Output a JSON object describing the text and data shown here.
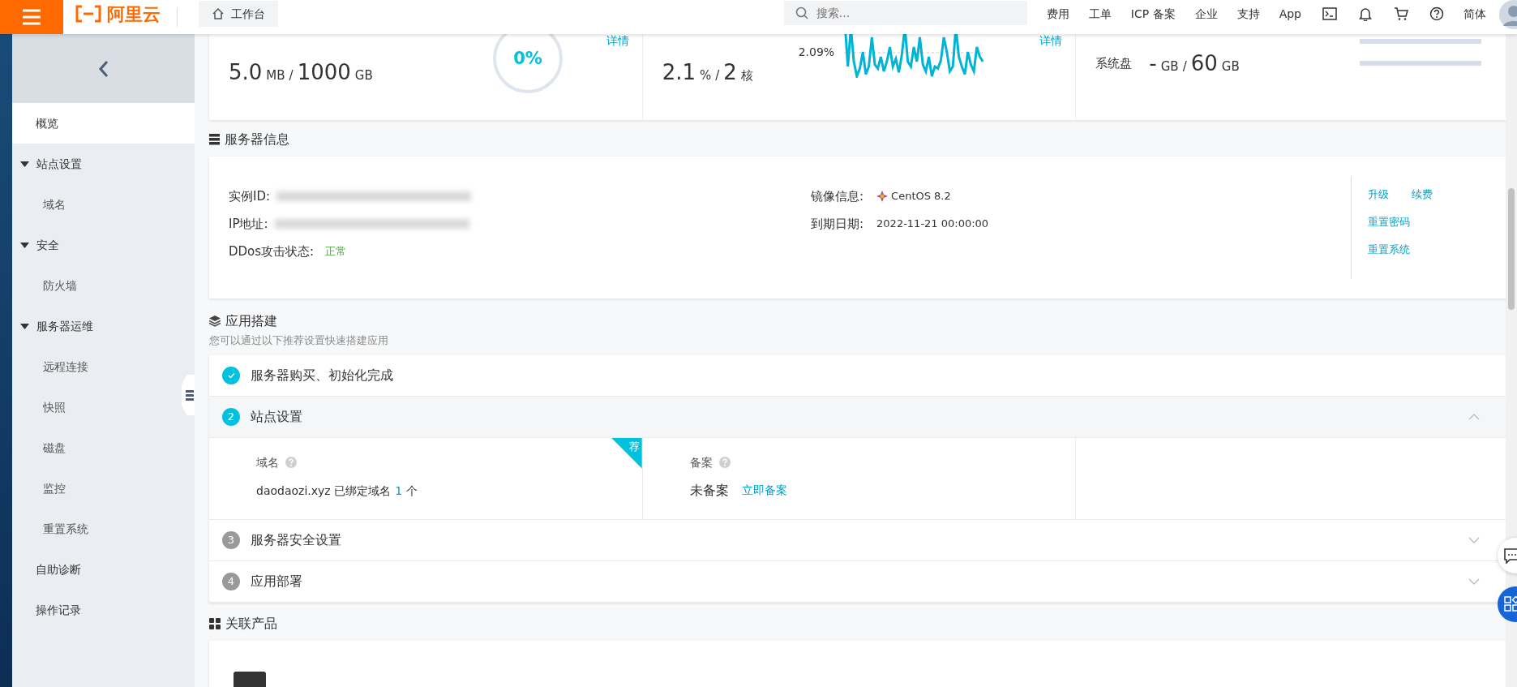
{
  "header": {
    "brand": "阿里云",
    "workbench": "工作台",
    "search_placeholder": "搜索...",
    "nav": [
      "费用",
      "工单",
      "ICP 备案",
      "企业",
      "支持",
      "App"
    ],
    "language": "简体"
  },
  "sidebar": {
    "items": [
      {
        "label": "概览",
        "selected": true
      },
      {
        "label": "站点设置",
        "selected": false,
        "expanded": true,
        "children": [
          {
            "label": "域名",
            "selected": false
          }
        ]
      },
      {
        "label": "安全",
        "selected": false,
        "expanded": true,
        "children": [
          {
            "label": "防火墙",
            "selected": false
          }
        ]
      },
      {
        "label": "服务器运维",
        "selected": false,
        "expanded": true,
        "children": [
          {
            "label": "远程连接",
            "selected": false
          },
          {
            "label": "快照",
            "selected": false
          },
          {
            "label": "磁盘",
            "selected": false
          },
          {
            "label": "监控",
            "selected": false
          },
          {
            "label": "重置系统",
            "selected": false
          }
        ]
      },
      {
        "label": "自助诊断",
        "selected": false
      },
      {
        "label": "操作记录",
        "selected": false
      }
    ]
  },
  "usage_cards": [
    {
      "kind": "gauge",
      "link": "详情",
      "value": "5.0",
      "unit": "MB",
      "separator": "/",
      "total": "1000",
      "total_unit": "GB",
      "gauge_text": "0%"
    },
    {
      "kind": "sparkline",
      "link": "详情",
      "value": "2.1",
      "unit": "%",
      "separator": "/",
      "total": "2",
      "total_unit": "核",
      "line_label": "2.09%"
    },
    {
      "kind": "bars",
      "rows": [
        {
          "level": 0
        },
        {
          "label": "系统盘",
          "value": "-",
          "unit": "GB",
          "separator": "/",
          "total": "60",
          "total_unit": "GB",
          "level": 0
        }
      ]
    }
  ],
  "server_info": {
    "title": "服务器信息",
    "left_fields": [
      {
        "kind": "redacted",
        "label": "实例ID:"
      },
      {
        "kind": "redacted",
        "label": "IP地址:"
      },
      {
        "kind": "status",
        "label": "DDos攻击状态:",
        "value": "正常"
      }
    ],
    "right_fields": [
      {
        "kind": "os",
        "label": "镜像信息:",
        "value": "CentOS 8.2"
      },
      {
        "kind": "text",
        "label": "到期日期:",
        "value": "2022-11-21 00:00:00"
      }
    ],
    "actions": [
      [
        "升级",
        "续费"
      ],
      [
        "重置密码"
      ],
      [
        "重置系统"
      ]
    ]
  },
  "app_build": {
    "title": "应用搭建",
    "subtitle": "您可以通过以下推荐设置快速搭建应用",
    "steps": [
      {
        "done": true,
        "label": "服务器购买、初始化完成"
      },
      {
        "done": false,
        "number": "2",
        "label": "站点设置",
        "expanded": true
      },
      {
        "done": false,
        "number": "3",
        "label": "服务器安全设置",
        "expanded": false
      },
      {
        "done": false,
        "number": "4",
        "label": "应用部署",
        "expanded": false
      }
    ],
    "panel": {
      "domain": {
        "label": "域名",
        "text": "daodaozi.xyz 已绑定域名",
        "count": "1",
        "count_unit": "个",
        "badge": "荐"
      },
      "filing": {
        "label": "备案",
        "value": "未备案",
        "link": "立即备案"
      }
    }
  },
  "related": {
    "title": "关联产品"
  }
}
